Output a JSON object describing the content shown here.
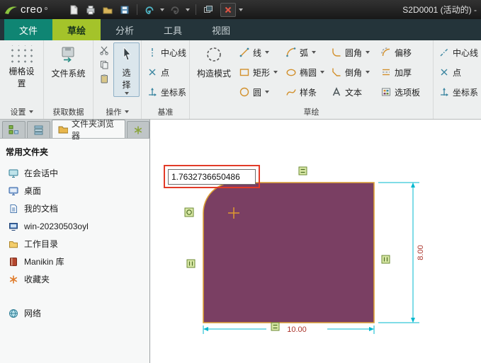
{
  "titlebar": {
    "logo": "creo",
    "doc_title": "S2D0001 (活动的) -"
  },
  "tabs": [
    {
      "label": "文件"
    },
    {
      "label": "草绘"
    },
    {
      "label": "分析"
    },
    {
      "label": "工具"
    },
    {
      "label": "视图"
    }
  ],
  "ribbon": {
    "grid": {
      "button": "栅格设置",
      "footer": "设置"
    },
    "filesys": {
      "button": "文件系统",
      "footer": "获取数据"
    },
    "ops": {
      "select": "选择",
      "footer": "操作"
    },
    "datum": {
      "footer": "基准",
      "items": [
        {
          "label": "中心线"
        },
        {
          "label": "点"
        },
        {
          "label": "坐标系"
        }
      ]
    },
    "sketch": {
      "construction": "构造模式",
      "footer": "草绘",
      "cols": [
        {
          "items": [
            {
              "label": "线"
            },
            {
              "label": "矩形"
            },
            {
              "label": "圆"
            }
          ]
        },
        {
          "items": [
            {
              "label": "弧"
            },
            {
              "label": "椭圆"
            },
            {
              "label": "样条"
            }
          ]
        },
        {
          "items": [
            {
              "label": "圆角"
            },
            {
              "label": "倒角"
            },
            {
              "label": "文本"
            }
          ]
        },
        {
          "items": [
            {
              "label": "偏移"
            },
            {
              "label": "加厚"
            },
            {
              "label": "选项板"
            }
          ]
        },
        {
          "items": [
            {
              "label": "中心线"
            },
            {
              "label": "点"
            },
            {
              "label": "坐标系"
            }
          ]
        }
      ]
    }
  },
  "navigator": {
    "folder_tab": "文件夹浏览器",
    "header": "常用文件夹",
    "items": [
      {
        "label": "在会话中"
      },
      {
        "label": "桌面"
      },
      {
        "label": "我的文档"
      },
      {
        "label": "win-20230503oyl"
      },
      {
        "label": "工作目录"
      },
      {
        "label": "Manikin 库"
      },
      {
        "label": "收藏夹"
      },
      {
        "label": "网络"
      }
    ]
  },
  "canvas": {
    "edit_value": "1.7632736650486",
    "dims": {
      "height": "8.00",
      "width": "10.00"
    },
    "colors": {
      "shape_fill": "#7a3f63",
      "shape_stroke": "#dca035",
      "dimension_line": "#00b8cf",
      "dimension_text": "#ab352c",
      "handle_fill": "#d9e8a6",
      "handle_stroke": "#6b8a34",
      "highlight_box": "#e23b28"
    }
  }
}
